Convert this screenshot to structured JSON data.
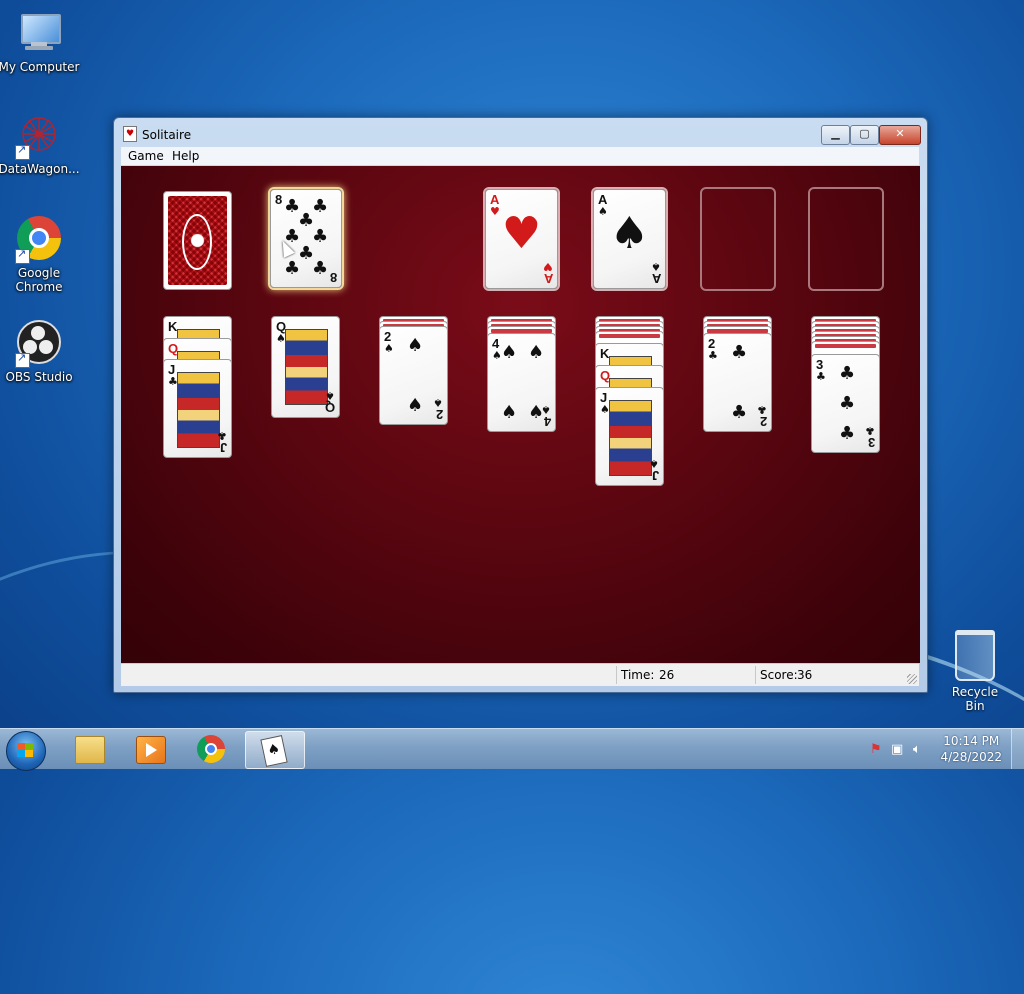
{
  "desktop": {
    "icons": [
      {
        "label": "My Computer",
        "icon": "computer-icon"
      },
      {
        "label": "DataWagon...",
        "icon": "datawagon-icon"
      },
      {
        "label": "Google Chrome",
        "icon": "chrome-icon"
      },
      {
        "label": "OBS Studio",
        "icon": "obs-icon"
      }
    ],
    "recycle_bin": "Recycle Bin"
  },
  "window": {
    "title": "Solitaire",
    "controls": {
      "minimize": "▁",
      "maximize": "▢",
      "close": "✕"
    },
    "menu": [
      "Game",
      "Help"
    ],
    "status": {
      "time_label": "Time:",
      "time_value": "26",
      "score_label": "Score:",
      "score_value": "36"
    }
  },
  "game": {
    "stock": {
      "face": "back"
    },
    "waste": {
      "rank": "8",
      "suit": "♣",
      "color": "black"
    },
    "foundations": [
      {
        "rank": "A",
        "suit": "♥",
        "color": "red"
      },
      {
        "rank": "A",
        "suit": "♠",
        "color": "black"
      },
      {
        "rank": "",
        "suit": ""
      },
      {
        "rank": "",
        "suit": ""
      }
    ],
    "tableau": [
      {
        "hidden": 0,
        "cards": [
          {
            "rank": "K",
            "suit": "♣",
            "color": "black"
          },
          {
            "rank": "Q",
            "suit": "♥",
            "color": "red"
          },
          {
            "rank": "J",
            "suit": "♣",
            "color": "black"
          }
        ]
      },
      {
        "hidden": 0,
        "cards": [
          {
            "rank": "Q",
            "suit": "♠",
            "color": "black"
          }
        ]
      },
      {
        "hidden": 2,
        "cards": [
          {
            "rank": "2",
            "suit": "♠",
            "color": "black"
          }
        ]
      },
      {
        "hidden": 3,
        "cards": [
          {
            "rank": "4",
            "suit": "♠",
            "color": "black"
          }
        ]
      },
      {
        "hidden": 4,
        "cards": [
          {
            "rank": "K",
            "suit": "♠",
            "color": "black"
          },
          {
            "rank": "Q",
            "suit": "♦",
            "color": "red"
          },
          {
            "rank": "J",
            "suit": "♠",
            "color": "black"
          }
        ]
      },
      {
        "hidden": 3,
        "cards": [
          {
            "rank": "2",
            "suit": "♣",
            "color": "black"
          }
        ]
      },
      {
        "hidden": 6,
        "cards": [
          {
            "rank": "3",
            "suit": "♣",
            "color": "black"
          }
        ]
      }
    ]
  },
  "taskbar": {
    "start": "Start",
    "pinned": [
      "File Explorer",
      "Media Player",
      "Google Chrome",
      "Solitaire"
    ],
    "active": "Solitaire",
    "time": "10:14 PM",
    "date": "4/28/2022"
  },
  "colors": {
    "felt": "#5a0610",
    "desktop": "#1d6bbd",
    "card_back": "#b8202a"
  }
}
